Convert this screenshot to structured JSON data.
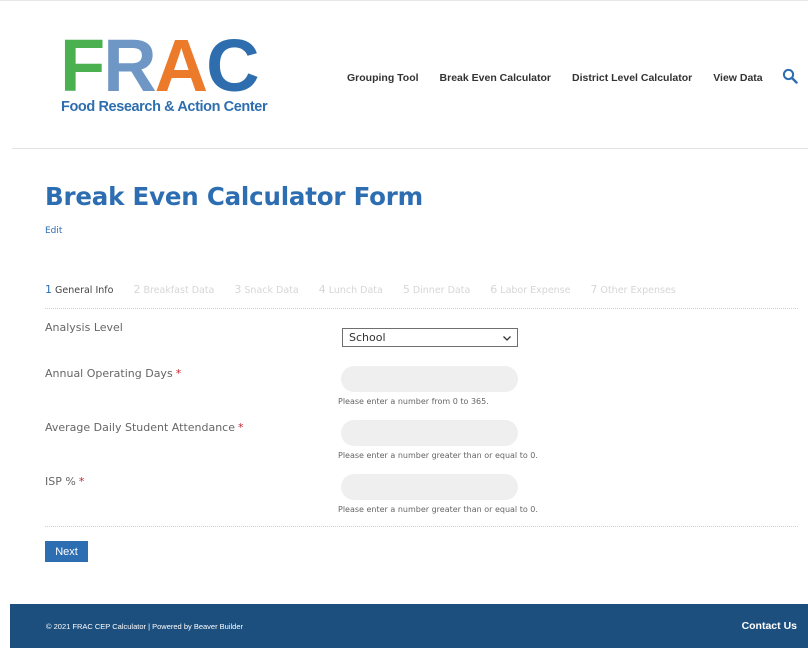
{
  "logo": {
    "letters": [
      "F",
      "R",
      "A",
      "C"
    ],
    "letter_colors": [
      "#4bb04f",
      "#6f97c6",
      "#ec7a2b",
      "#2f6eae"
    ],
    "subtitle": "Food Research & Action Center"
  },
  "nav": {
    "items": [
      "Grouping Tool",
      "Break Even Calculator",
      "District Level Calculator",
      "View Data"
    ],
    "search_icon": "search-icon"
  },
  "page": {
    "title": "Break Even Calculator Form",
    "edit_label": "Edit"
  },
  "steps": [
    {
      "num": "1",
      "label": "General Info",
      "active": true
    },
    {
      "num": "2",
      "label": "Breakfast Data",
      "active": false
    },
    {
      "num": "3",
      "label": "Snack Data",
      "active": false
    },
    {
      "num": "4",
      "label": "Lunch Data",
      "active": false
    },
    {
      "num": "5",
      "label": "Dinner Data",
      "active": false
    },
    {
      "num": "6",
      "label": "Labor Expense",
      "active": false
    },
    {
      "num": "7",
      "label": "Other Expenses",
      "active": false
    }
  ],
  "form": {
    "analysis_level": {
      "label": "Analysis Level",
      "value": "School"
    },
    "annual_operating_days": {
      "label": "Annual Operating Days",
      "required": "*",
      "value": "",
      "hint": "Please enter a number from 0 to 365."
    },
    "avg_daily_attendance": {
      "label": "Average Daily Student Attendance",
      "required": "*",
      "value": "",
      "hint": "Please enter a number greater than or equal to 0."
    },
    "isp": {
      "label": "ISP %",
      "required": "*",
      "value": "",
      "hint": "Please enter a number greater than or equal to 0."
    },
    "next_label": "Next"
  },
  "footer": {
    "copyright": "© 2021 FRAC CEP Calculator | Powered by Beaver Builder",
    "contact_label": "Contact Us"
  },
  "colors": {
    "accent": "#2d6eb2",
    "footer_bg": "#1c4f7e",
    "required": "#c0262d"
  }
}
